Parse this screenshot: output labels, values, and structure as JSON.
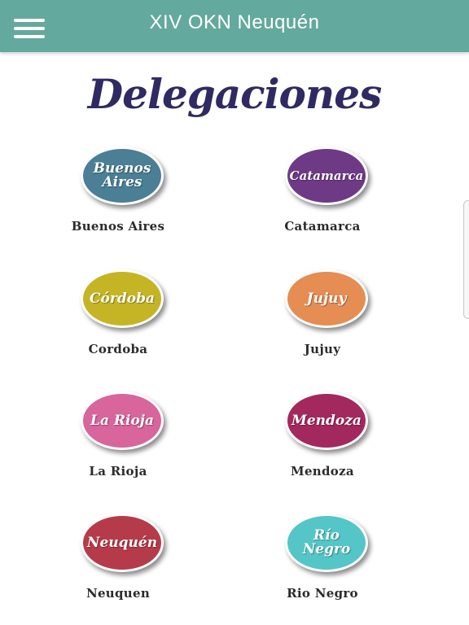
{
  "app_bar": {
    "title": "XIV OKN Neuquén",
    "background": "#63a99d",
    "menu_icon": "hamburger-menu-icon"
  },
  "heading": "Delegaciones",
  "delegations": [
    {
      "badge": "Buenos\nAires",
      "label": "Buenos Aires",
      "color": "#4a7f95"
    },
    {
      "badge": "Catamarca",
      "label": "Catamarca",
      "color": "#6e3a86"
    },
    {
      "badge": "Córdoba",
      "label": "Cordoba",
      "color": "#c5b525"
    },
    {
      "badge": "Jujuy",
      "label": "Jujuy",
      "color": "#e58d52"
    },
    {
      "badge": "La Rioja",
      "label": "La Rioja",
      "color": "#d8659c"
    },
    {
      "badge": "Mendoza",
      "label": "Mendoza",
      "color": "#a3285e"
    },
    {
      "badge": "Neuquén",
      "label": "Neuquen",
      "color": "#b63b4a"
    },
    {
      "badge": "Río Negro",
      "label": "Rio Negro",
      "color": "#54c6c7"
    }
  ]
}
